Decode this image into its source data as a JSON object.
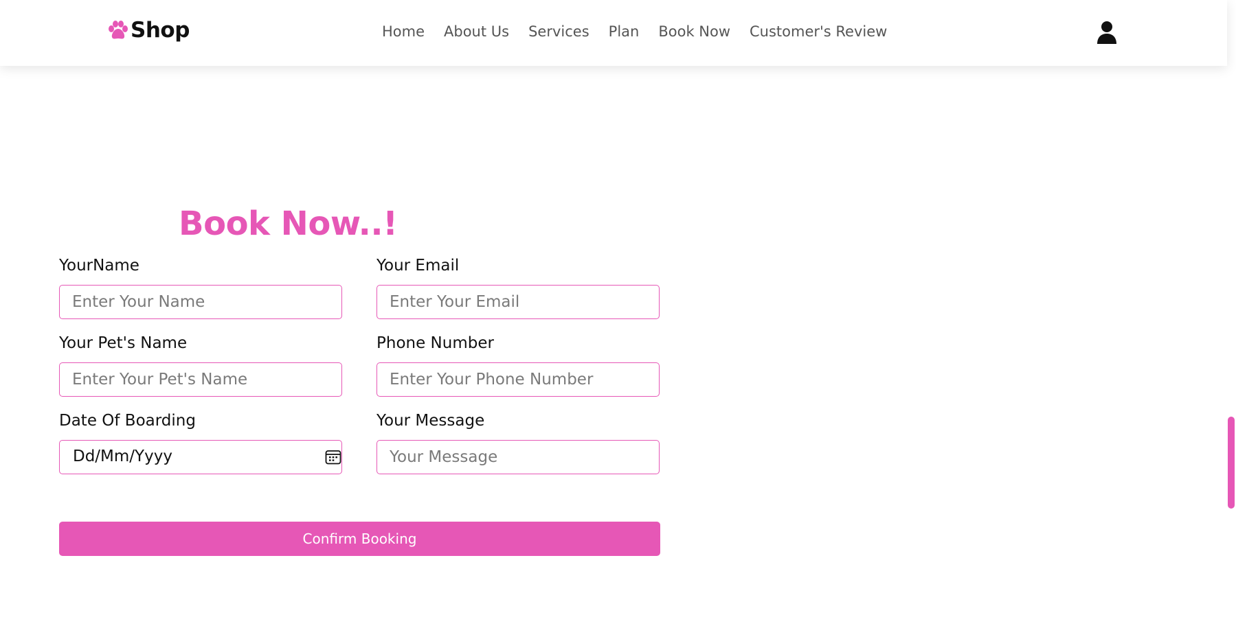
{
  "brand": {
    "name": "Shop",
    "icon": "paw-icon",
    "accent_color": "#e657b6"
  },
  "nav": {
    "items": [
      {
        "label": "Home"
      },
      {
        "label": "About Us"
      },
      {
        "label": "Services"
      },
      {
        "label": "Plan"
      },
      {
        "label": "Book Now"
      },
      {
        "label": "Customer's Review"
      }
    ],
    "user_icon": "user-icon"
  },
  "form": {
    "title": "Book Now..!",
    "name": {
      "label": "YourName",
      "placeholder": "Enter Your Name"
    },
    "email": {
      "label": "Your Email",
      "placeholder": "Enter Your Email"
    },
    "pet_name": {
      "label": "Your Pet's Name",
      "placeholder": "Enter Your Pet's Name"
    },
    "phone": {
      "label": "Phone Number",
      "placeholder": "Enter Your Phone Number"
    },
    "date": {
      "label": "Date Of Boarding",
      "value": "Dd/Mm/Yyyy",
      "icon": "calendar-icon"
    },
    "message": {
      "label": "Your Message",
      "placeholder": "Your Message"
    },
    "submit_label": "Confirm Booking"
  },
  "colors": {
    "accent": "#e657b6",
    "text": "#111111",
    "nav_text": "#555555"
  }
}
